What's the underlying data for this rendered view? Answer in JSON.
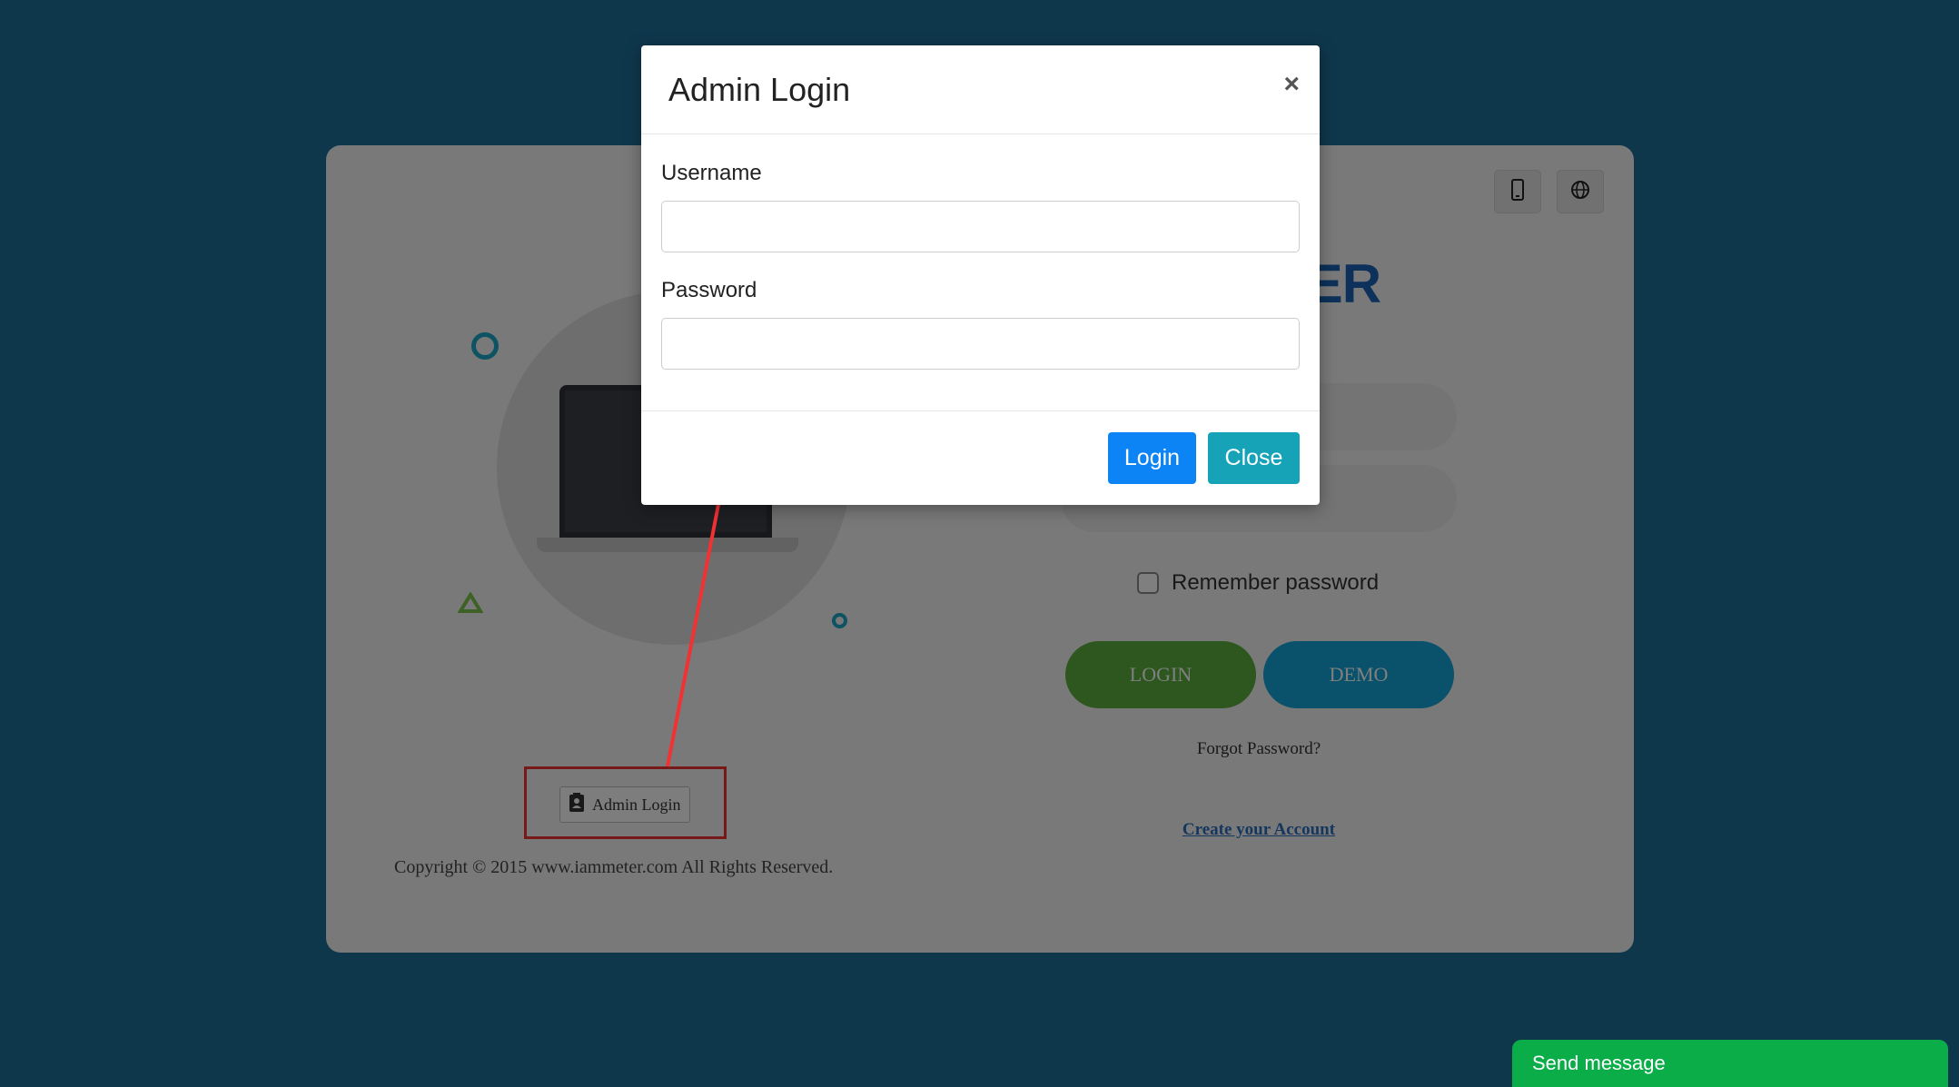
{
  "background_page": {
    "brand_visible_text": "ETER",
    "remember_password_label": "Remember password",
    "login_button_label": "LOGIN",
    "demo_button_label": "DEMO",
    "forgot_password_label": "Forgot Password?",
    "create_account_label": "Create your Account",
    "admin_login_button_label": "Admin Login",
    "copyright_text": "Copyright © 2015 www.iammeter.com All Rights Reserved.",
    "icons": [
      "mobile-phone-icon",
      "globe-icon",
      "contact-card-icon"
    ]
  },
  "modal": {
    "title": "Admin Login",
    "close_icon": "×",
    "username_label": "Username",
    "username_value": "",
    "password_label": "Password",
    "password_value": "",
    "login_button_label": "Login",
    "close_button_label": "Close"
  },
  "chat_widget": {
    "label": "Send message"
  },
  "colors": {
    "page_background": "#1f6f98",
    "modal_login_button": "#0d84f5",
    "modal_close_button": "#16a3b8",
    "main_login_button": "#5aaf3c",
    "demo_button": "#14a3d6",
    "annotation_red": "#f03232",
    "chat_widget": "#0aad48"
  }
}
